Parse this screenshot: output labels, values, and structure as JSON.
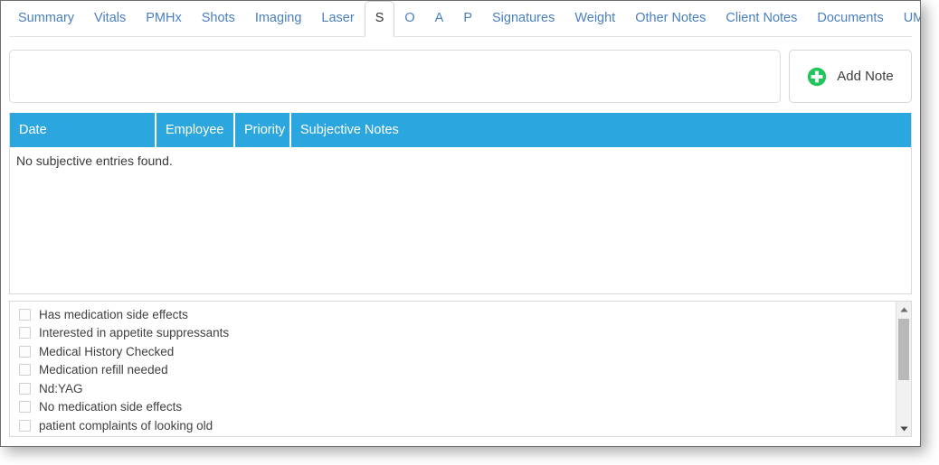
{
  "tabs": [
    {
      "label": "Summary",
      "active": false
    },
    {
      "label": "Vitals",
      "active": false
    },
    {
      "label": "PMHx",
      "active": false
    },
    {
      "label": "Shots",
      "active": false
    },
    {
      "label": "Imaging",
      "active": false
    },
    {
      "label": "Laser",
      "active": false
    },
    {
      "label": "S",
      "active": true
    },
    {
      "label": "O",
      "active": false
    },
    {
      "label": "A",
      "active": false
    },
    {
      "label": "P",
      "active": false
    },
    {
      "label": "Signatures",
      "active": false
    },
    {
      "label": "Weight",
      "active": false
    },
    {
      "label": "Other Notes",
      "active": false
    },
    {
      "label": "Client Notes",
      "active": false
    },
    {
      "label": "Documents",
      "active": false
    },
    {
      "label": "UMR Forms",
      "active": false
    }
  ],
  "entry": {
    "note_value": "",
    "note_placeholder": "",
    "add_button_label": "Add Note",
    "add_button_icon": "plus-circle-icon",
    "add_button_icon_color": "#22c55b"
  },
  "table": {
    "header_bg": "#2ba6de",
    "columns": [
      "Date",
      "Employee",
      "Priority",
      "Subjective Notes"
    ],
    "rows": [],
    "empty_message": "No subjective entries found."
  },
  "checklist": {
    "items": [
      {
        "label": "Has medication side effects",
        "checked": false
      },
      {
        "label": "Interested in appetite suppressants",
        "checked": false
      },
      {
        "label": "Medical History Checked",
        "checked": false
      },
      {
        "label": "Medication refill needed",
        "checked": false
      },
      {
        "label": "Nd:YAG",
        "checked": false
      },
      {
        "label": "No medication side effects",
        "checked": false
      },
      {
        "label": "patient complaints of looking old",
        "checked": false
      },
      {
        "label": "",
        "checked": false
      }
    ],
    "scroll": {
      "up_icon": "chevron-up-icon",
      "down_icon": "chevron-down-icon"
    }
  },
  "theme": {
    "accent_blue": "#2ba6de",
    "link_blue": "#4a7fbe",
    "green": "#22c55b"
  }
}
